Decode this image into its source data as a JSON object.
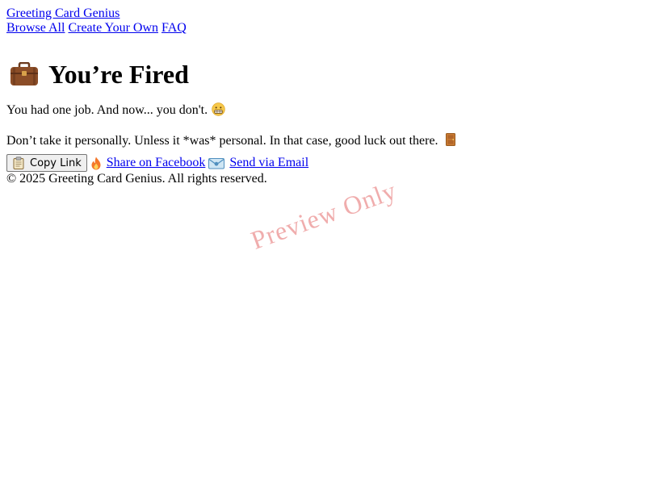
{
  "site": {
    "title": "Greeting Card Genius"
  },
  "nav": {
    "items": [
      "Browse All",
      "Create Your Own",
      "FAQ"
    ]
  },
  "card": {
    "title": "You’re Fired",
    "title_icon": "briefcase-icon",
    "message_1": "You had one job. And now... you don't.",
    "message_1_icon": "grimacing-face-icon",
    "message_2": "Don’t take it personally. Unless it *was* personal. In that case, good luck out there.",
    "message_2_icon": "door-icon"
  },
  "actions": {
    "copy_label": "Copy Link",
    "copy_icon": "clipboard-icon",
    "facebook_label": "Share on Facebook",
    "facebook_icon": "fire-icon",
    "email_label": "Send via Email",
    "email_icon": "envelope-icon"
  },
  "footer": {
    "text": "© 2025 Greeting Card Genius. All rights reserved."
  },
  "watermark": {
    "text": "Preview Only"
  },
  "colors": {
    "link": "#0000ee",
    "watermark": "#dc3c3c"
  }
}
